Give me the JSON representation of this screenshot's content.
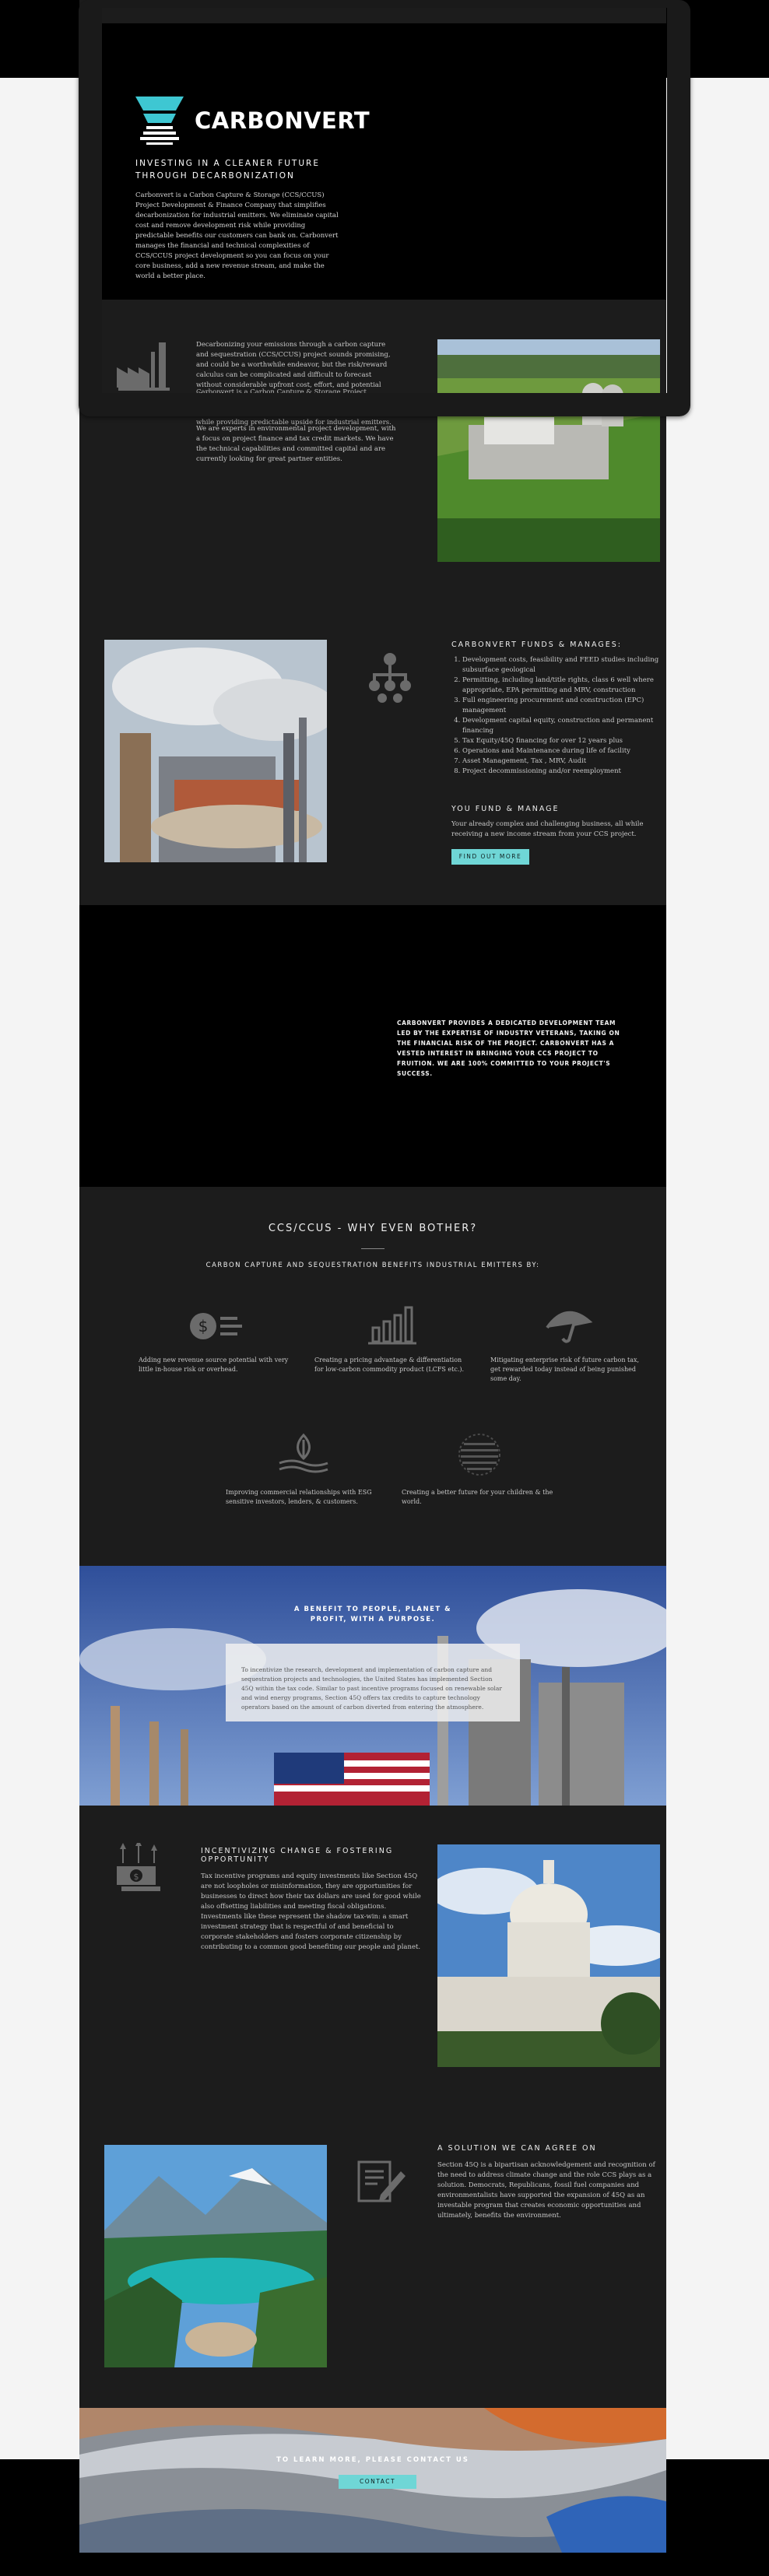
{
  "brand": {
    "name": "CARBONVERT",
    "accent": "#3ec7d2"
  },
  "hero": {
    "tagline": "INVESTING IN A CLEANER FUTURE THROUGH DECARBONIZATION",
    "body": "Carbonvert is a Carbon Capture & Storage (CCS/CCUS) Project Development & Finance Company that simplifies decarbonization for industrial emitters. We eliminate capital cost and remove development risk while providing predictable benefits our customers can bank on. Carbonvert manages the financial and technical complexities of CCS/CCUS project development so you can focus on your core business, add a new revenue stream, and make the world a better place."
  },
  "intro": {
    "p1": "Decarbonizing your emissions through a carbon capture and sequestration (CCS/CCUS) project sounds promising, and could be a worthwhile endeavor, but the risk/reward calculus can be complicated and difficult to forecast without considerable upfront cost, effort, and potential distraction.",
    "p2": "Carbonvert is a Carbon Capture & Storage Project Development & Finance Company that makes decarbonization easy. We remove project development risk while providing predictable upside for industrial emitters.",
    "p3": "We are experts in environmental project development, with a focus on project finance and tax credit markets. We have the technical capabilities and committed capital and are currently looking for great partner entities."
  },
  "funds": {
    "title": "CARBONVERT FUNDS & MANAGES:",
    "items": [
      "Development costs, feasibility and FEED studies including subsurface geological",
      "Permitting, including land/title rights, class 6 well where appropriate, EPA permitting and MRV, construction",
      "Full engineering procurement and construction (EPC) management",
      "Development capital equity, construction and permanent financing",
      "Tax Equity/45Q financing for over 12 years plus",
      "Operations and Maintenance during life of facility",
      "Asset Management, Tax , MRV, Audit",
      "Project decommissioning and/or reemployment"
    ],
    "sub_title": "YOU FUND & MANAGE",
    "sub_body": "Your already complex and challenging business, all while receiving a new income stream from your CCS project.",
    "button": "FIND OUT MORE"
  },
  "statement": {
    "text": "CARBONVERT PROVIDES A DEDICATED DEVELOPMENT TEAM LED BY THE EXPERTISE OF INDUSTRY VETERANS, TAKING ON THE FINANCIAL RISK OF THE PROJECT. CARBONVERT HAS A VESTED INTEREST IN BRINGING YOUR CCS PROJECT TO FRUITION. WE ARE 100% COMMITTED TO YOUR PROJECT'S SUCCESS."
  },
  "why": {
    "title": "CCS/CCUS - WHY EVEN BOTHER?",
    "subtitle": "CARBON CAPTURE AND SEQUESTRATION BENEFITS INDUSTRIAL EMITTERS BY:",
    "items": [
      {
        "icon": "dollar-coin-icon",
        "text": "Adding new revenue source potential with very little in-house risk or overhead."
      },
      {
        "icon": "bar-chart-icon",
        "text": "Creating a pricing advantage & differentiation for low-carbon commodity product (LCFS etc.)."
      },
      {
        "icon": "umbrella-icon",
        "text": "Mitigating enterprise risk of future carbon tax, get rewarded today instead of being punished some day."
      },
      {
        "icon": "leaf-hand-icon",
        "text": "Improving commercial relationships with ESG sensitive investors, lenders, & customers."
      },
      {
        "icon": "globe-icon",
        "text": "Creating a better future for your children & the world."
      }
    ]
  },
  "benefit": {
    "title": "A BENEFIT TO PEOPLE, PLANET & PROFIT, WITH A PURPOSE.",
    "body": "To incentivize the research, development and implementation of carbon capture and sequestration projects and technologies, the United States has implemented Section 45Q within the tax code. Similar to past incentive programs focused on renewable solar and wind energy programs, Section 45Q offers tax credits to capture technology operators based on the amount of carbon diverted from entering the atmosphere."
  },
  "incentive": {
    "title": "INCENTIVIZING CHANGE & FOSTERING OPPORTUNITY",
    "body": "Tax incentive programs and equity investments like Section 45Q are not loopholes or misinformation, they are opportunities for businesses to direct how their tax dollars are used for good while also offsetting liabilities and meeting fiscal obligations. Investments like these represent the shadow tax-win: a smart investment strategy that is respectful of and beneficial to corporate stakeholders and fosters corporate citizenship by contributing to a common good benefiting our people and planet."
  },
  "solution": {
    "title": "A SOLUTION WE CAN AGREE ON",
    "body": "Section 45Q is a bipartisan acknowledgement and recognition of the need to address climate change and the role CCS plays as a solution. Democrats, Republicans, fossil fuel companies and environmentalists have supported the expansion of 45Q as an investable program that creates economic opportunities and ultimately, benefits the environment."
  },
  "contact": {
    "title": "TO LEARN MORE, PLEASE CONTACT US",
    "button": "CONTACT"
  }
}
